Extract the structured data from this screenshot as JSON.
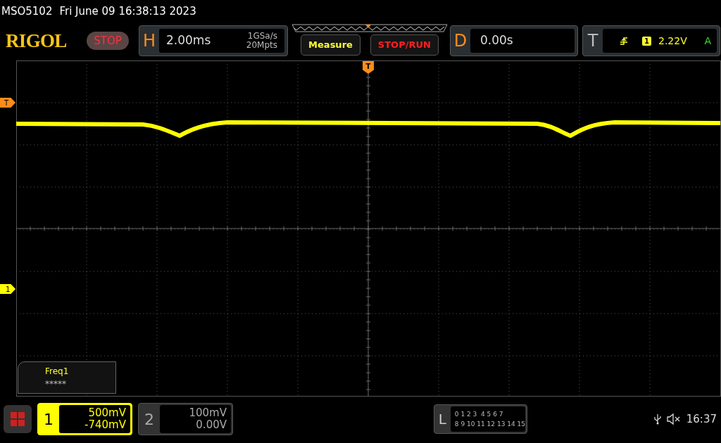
{
  "header": {
    "model": "MSO5102",
    "datetime": "Fri June 09 16:38:13 2023"
  },
  "logo": "RIGOL",
  "run_state": {
    "label": "STOP",
    "kind": "stop"
  },
  "horizontal": {
    "letter": "H",
    "timebase": "2.00ms",
    "sample_rate": "1GSa/s",
    "memory_depth": "20Mpts"
  },
  "buttons": [
    {
      "label": "Measure",
      "kind": "measure"
    },
    {
      "label": "STOP/RUN",
      "kind": "stoprun"
    }
  ],
  "delay": {
    "letter": "D",
    "value": "0.00s"
  },
  "trigger": {
    "letter": "T",
    "source": "1",
    "level": "2.22V",
    "mode": "A"
  },
  "markers": {
    "trigger_position": "T",
    "trigger_level": "T",
    "channel_1": "1"
  },
  "measurement": {
    "name": "Freq1",
    "value": "*****"
  },
  "channels": [
    {
      "number": "1",
      "scale": "500mV",
      "offset": "-740mV",
      "on": true
    },
    {
      "number": "2",
      "scale": "100mV",
      "offset": "0.00V",
      "on": false
    }
  ],
  "logic": {
    "letter": "L",
    "rows": [
      "0 1 2 3  4 5 6 7",
      "8 9 10 11 12 13 14 15"
    ]
  },
  "status": {
    "time": "16:37"
  }
}
